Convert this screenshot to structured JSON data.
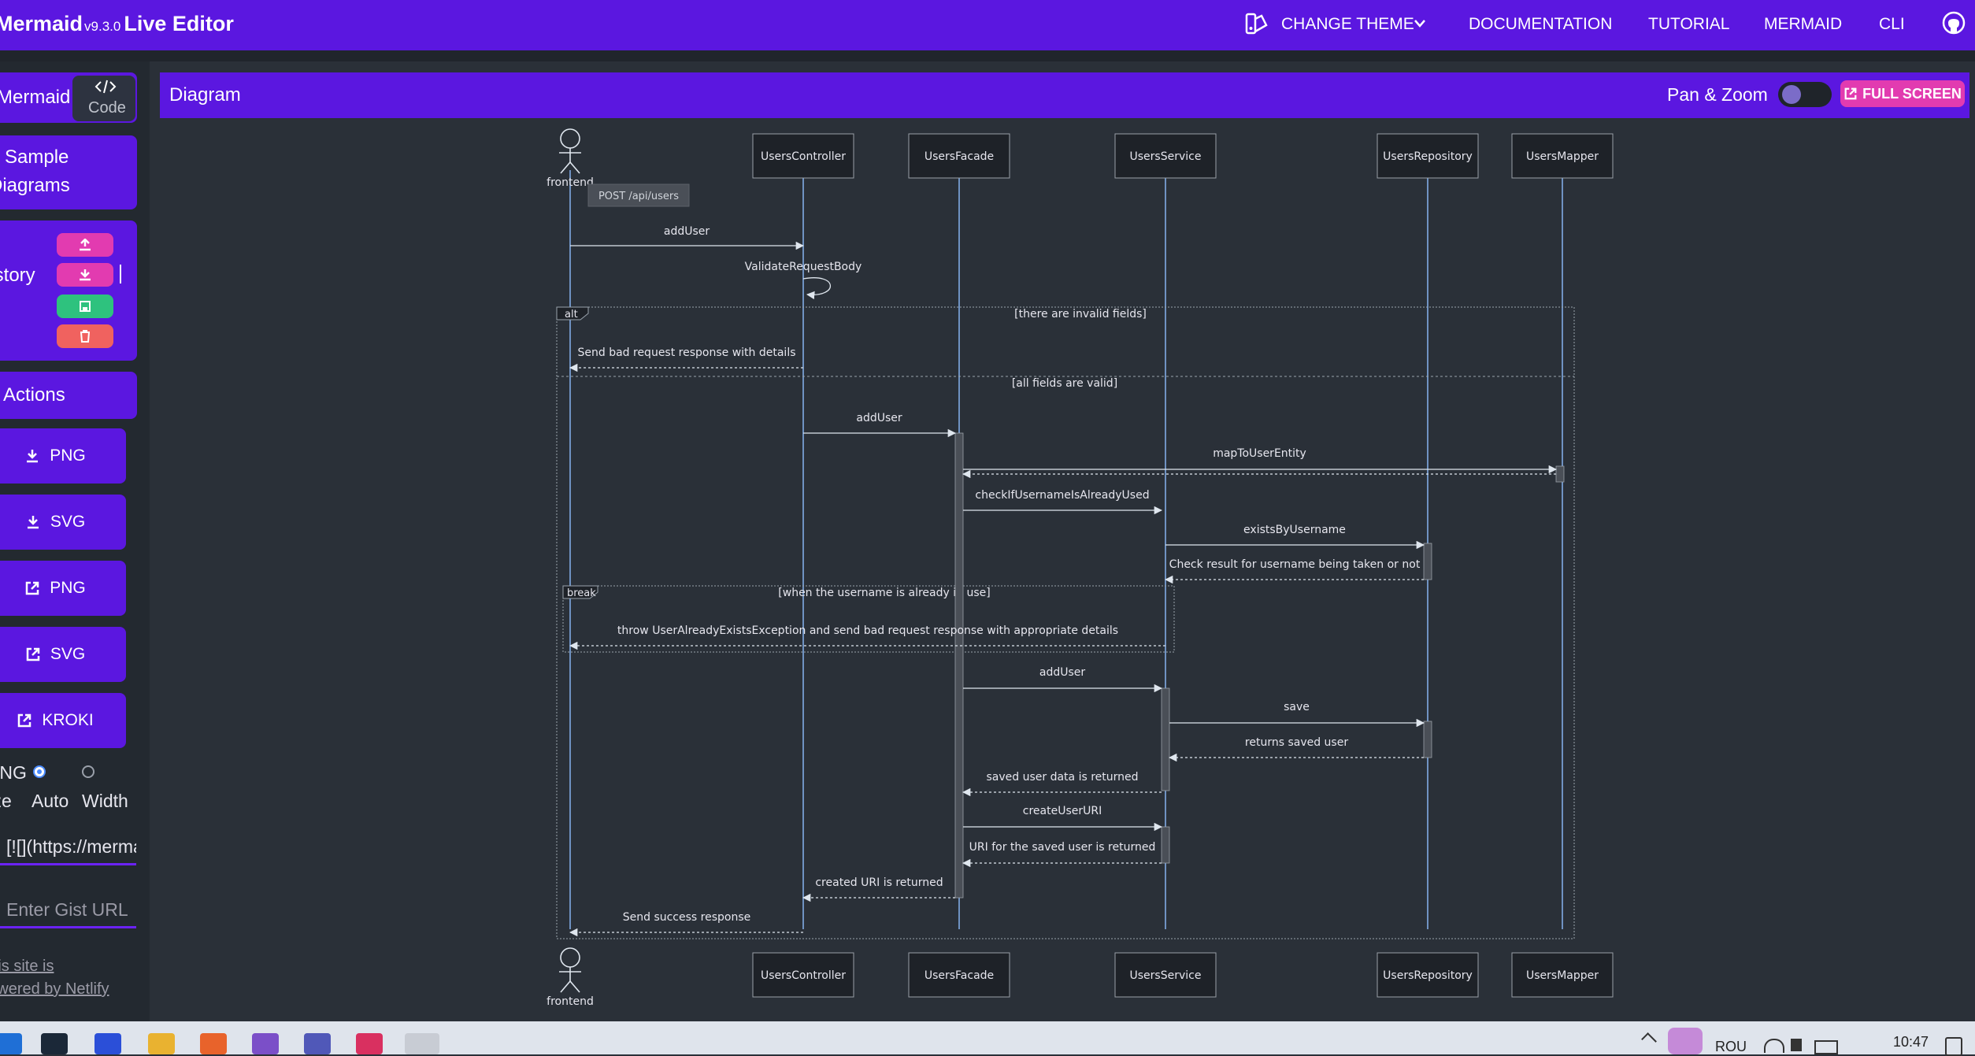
{
  "app": {
    "title_prefix": "Mermaid",
    "version": "v9.3.0",
    "title_suffix": "Live Editor"
  },
  "nav": {
    "change_theme": "CHANGE THEME",
    "documentation": "DOCUMENTATION",
    "tutorial": "TUTORIAL",
    "mermaid": "MERMAID",
    "cli": "CLI"
  },
  "sidebar": {
    "mermaid_tab": "Mermaid",
    "code_tab": "Code",
    "sample_line1": "Sample",
    "sample_line2": "Diagrams",
    "history": "History",
    "actions": "Actions",
    "buttons": [
      {
        "label": "PNG",
        "icon": "download-icon"
      },
      {
        "label": "SVG",
        "icon": "download-icon"
      },
      {
        "label": "PNG",
        "icon": "external-link-icon"
      },
      {
        "label": "SVG",
        "icon": "external-link-icon"
      },
      {
        "label": "KROKI",
        "icon": "external-link-icon"
      }
    ],
    "png_label": "PNG",
    "size_label": "Size",
    "auto_label": "Auto",
    "width_label": "Width",
    "markdown_value": "[![](https://mermaid.ink",
    "gist_placeholder": "Enter Gist URL",
    "footer_line1": "This site is",
    "footer_line2": "powered by Netlify"
  },
  "diagram_panel": {
    "title": "Diagram",
    "pan_zoom": "Pan & Zoom",
    "fullscreen": "FULL SCREEN"
  },
  "sequence": {
    "participants": [
      "frontend",
      "UsersController",
      "UsersFacade",
      "UsersService",
      "UsersRepository",
      "UsersMapper"
    ],
    "note": "POST /api/users",
    "messages": [
      "addUser",
      "ValidateRequestBody",
      "Send bad request response with details",
      "addUser",
      "mapToUserEntity",
      "checkIfUsernameIsAlreadyUsed",
      "existsByUsername",
      "Check result for username being taken or not",
      "throw UserAlreadyExistsException and send bad request response with appropriate details",
      "addUser",
      "save",
      "returns saved user",
      "saved user data is returned",
      "createUserURI",
      "URI for the saved user is returned",
      "created URI is returned",
      "Send success response"
    ],
    "alt_label": "alt",
    "alt_condition": "[there are invalid fields]",
    "else_condition": "[all fields are valid]",
    "break_label": "break",
    "break_condition": "[when the username is already in use]"
  },
  "taskbar": {
    "lang": "ROU",
    "time": "10:47"
  },
  "colors": {
    "accent": "#5b17e0",
    "pink": "#e23bb0",
    "green": "#2ec27e",
    "red": "#f0625f",
    "canvas": "#2a3038",
    "lifeline": "#86b3f0"
  }
}
